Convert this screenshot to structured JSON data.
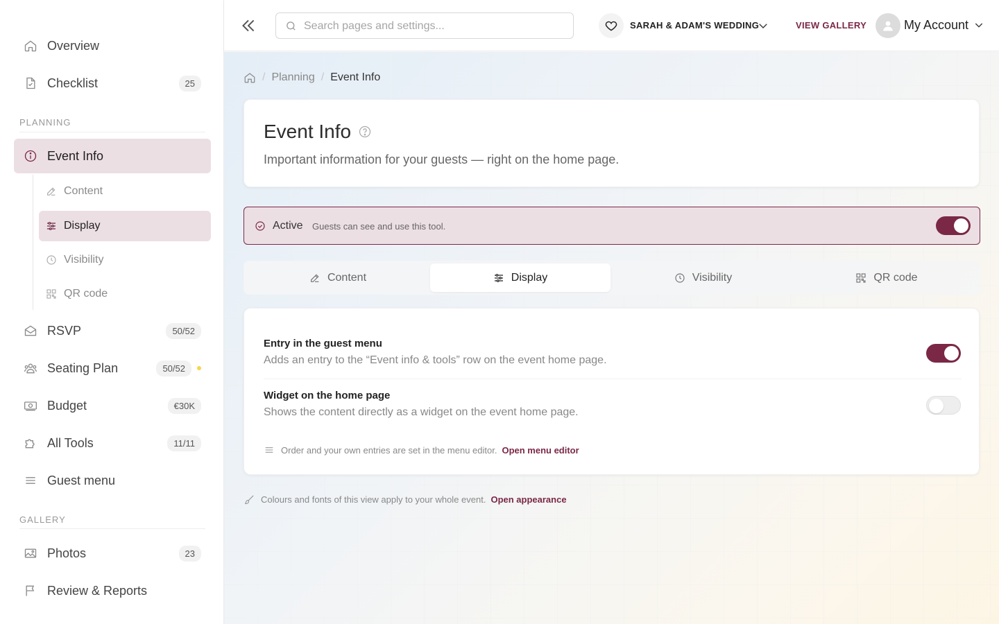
{
  "sidebar": {
    "top_items": [
      {
        "label": "Overview",
        "count": ""
      },
      {
        "label": "Checklist",
        "count": "25"
      }
    ],
    "planning_label": "PLANNING",
    "event_info": {
      "label": "Event Info"
    },
    "event_sub": [
      {
        "label": "Content"
      },
      {
        "label": "Display"
      },
      {
        "label": "Visibility"
      },
      {
        "label": "QR code"
      }
    ],
    "planning_items": [
      {
        "label": "RSVP",
        "count": "50/52"
      },
      {
        "label": "Seating Plan",
        "count": "50/52"
      },
      {
        "label": "Budget",
        "count": "€30K"
      },
      {
        "label": "All Tools",
        "count": "11/11"
      },
      {
        "label": "Guest menu",
        "count": ""
      }
    ],
    "gallery_label": "GALLERY",
    "gallery_items": [
      {
        "label": "Photos",
        "count": "23"
      },
      {
        "label": "Review & Reports",
        "count": ""
      }
    ]
  },
  "header": {
    "search_placeholder": "Search pages and settings...",
    "event_name": "SARAH & ADAM'S WEDDING",
    "view_gallery": "VIEW GALLERY",
    "account": "My Account"
  },
  "breadcrumb": {
    "items": [
      "Planning",
      "Event Info"
    ]
  },
  "page": {
    "title": "Event Info",
    "subtitle": "Important information for your guests — right on the home page."
  },
  "status": {
    "label": "Active",
    "description": "Guests can see and use this tool.",
    "enabled": true
  },
  "tabs": [
    {
      "label": "Content"
    },
    {
      "label": "Display"
    },
    {
      "label": "Visibility"
    },
    {
      "label": "QR code"
    }
  ],
  "active_tab": "Display",
  "settings": [
    {
      "title": "Entry in the guest menu",
      "description": "Adds an entry to the “Event info & tools” row on the event home page.",
      "enabled": true
    },
    {
      "title": "Widget on the home page",
      "description": "Shows the content directly as a widget on the event home page.",
      "enabled": false
    }
  ],
  "menu_note": {
    "text": "Order and your own entries are set in the menu editor.",
    "link": "Open menu editor"
  },
  "appearance_note": {
    "text": "Colours and fonts of this view apply to your whole event.",
    "link": "Open appearance"
  },
  "colors": {
    "accent": "#7a2846",
    "accent_light": "#ecdfe4",
    "badge_dot": "#f5d64a"
  }
}
